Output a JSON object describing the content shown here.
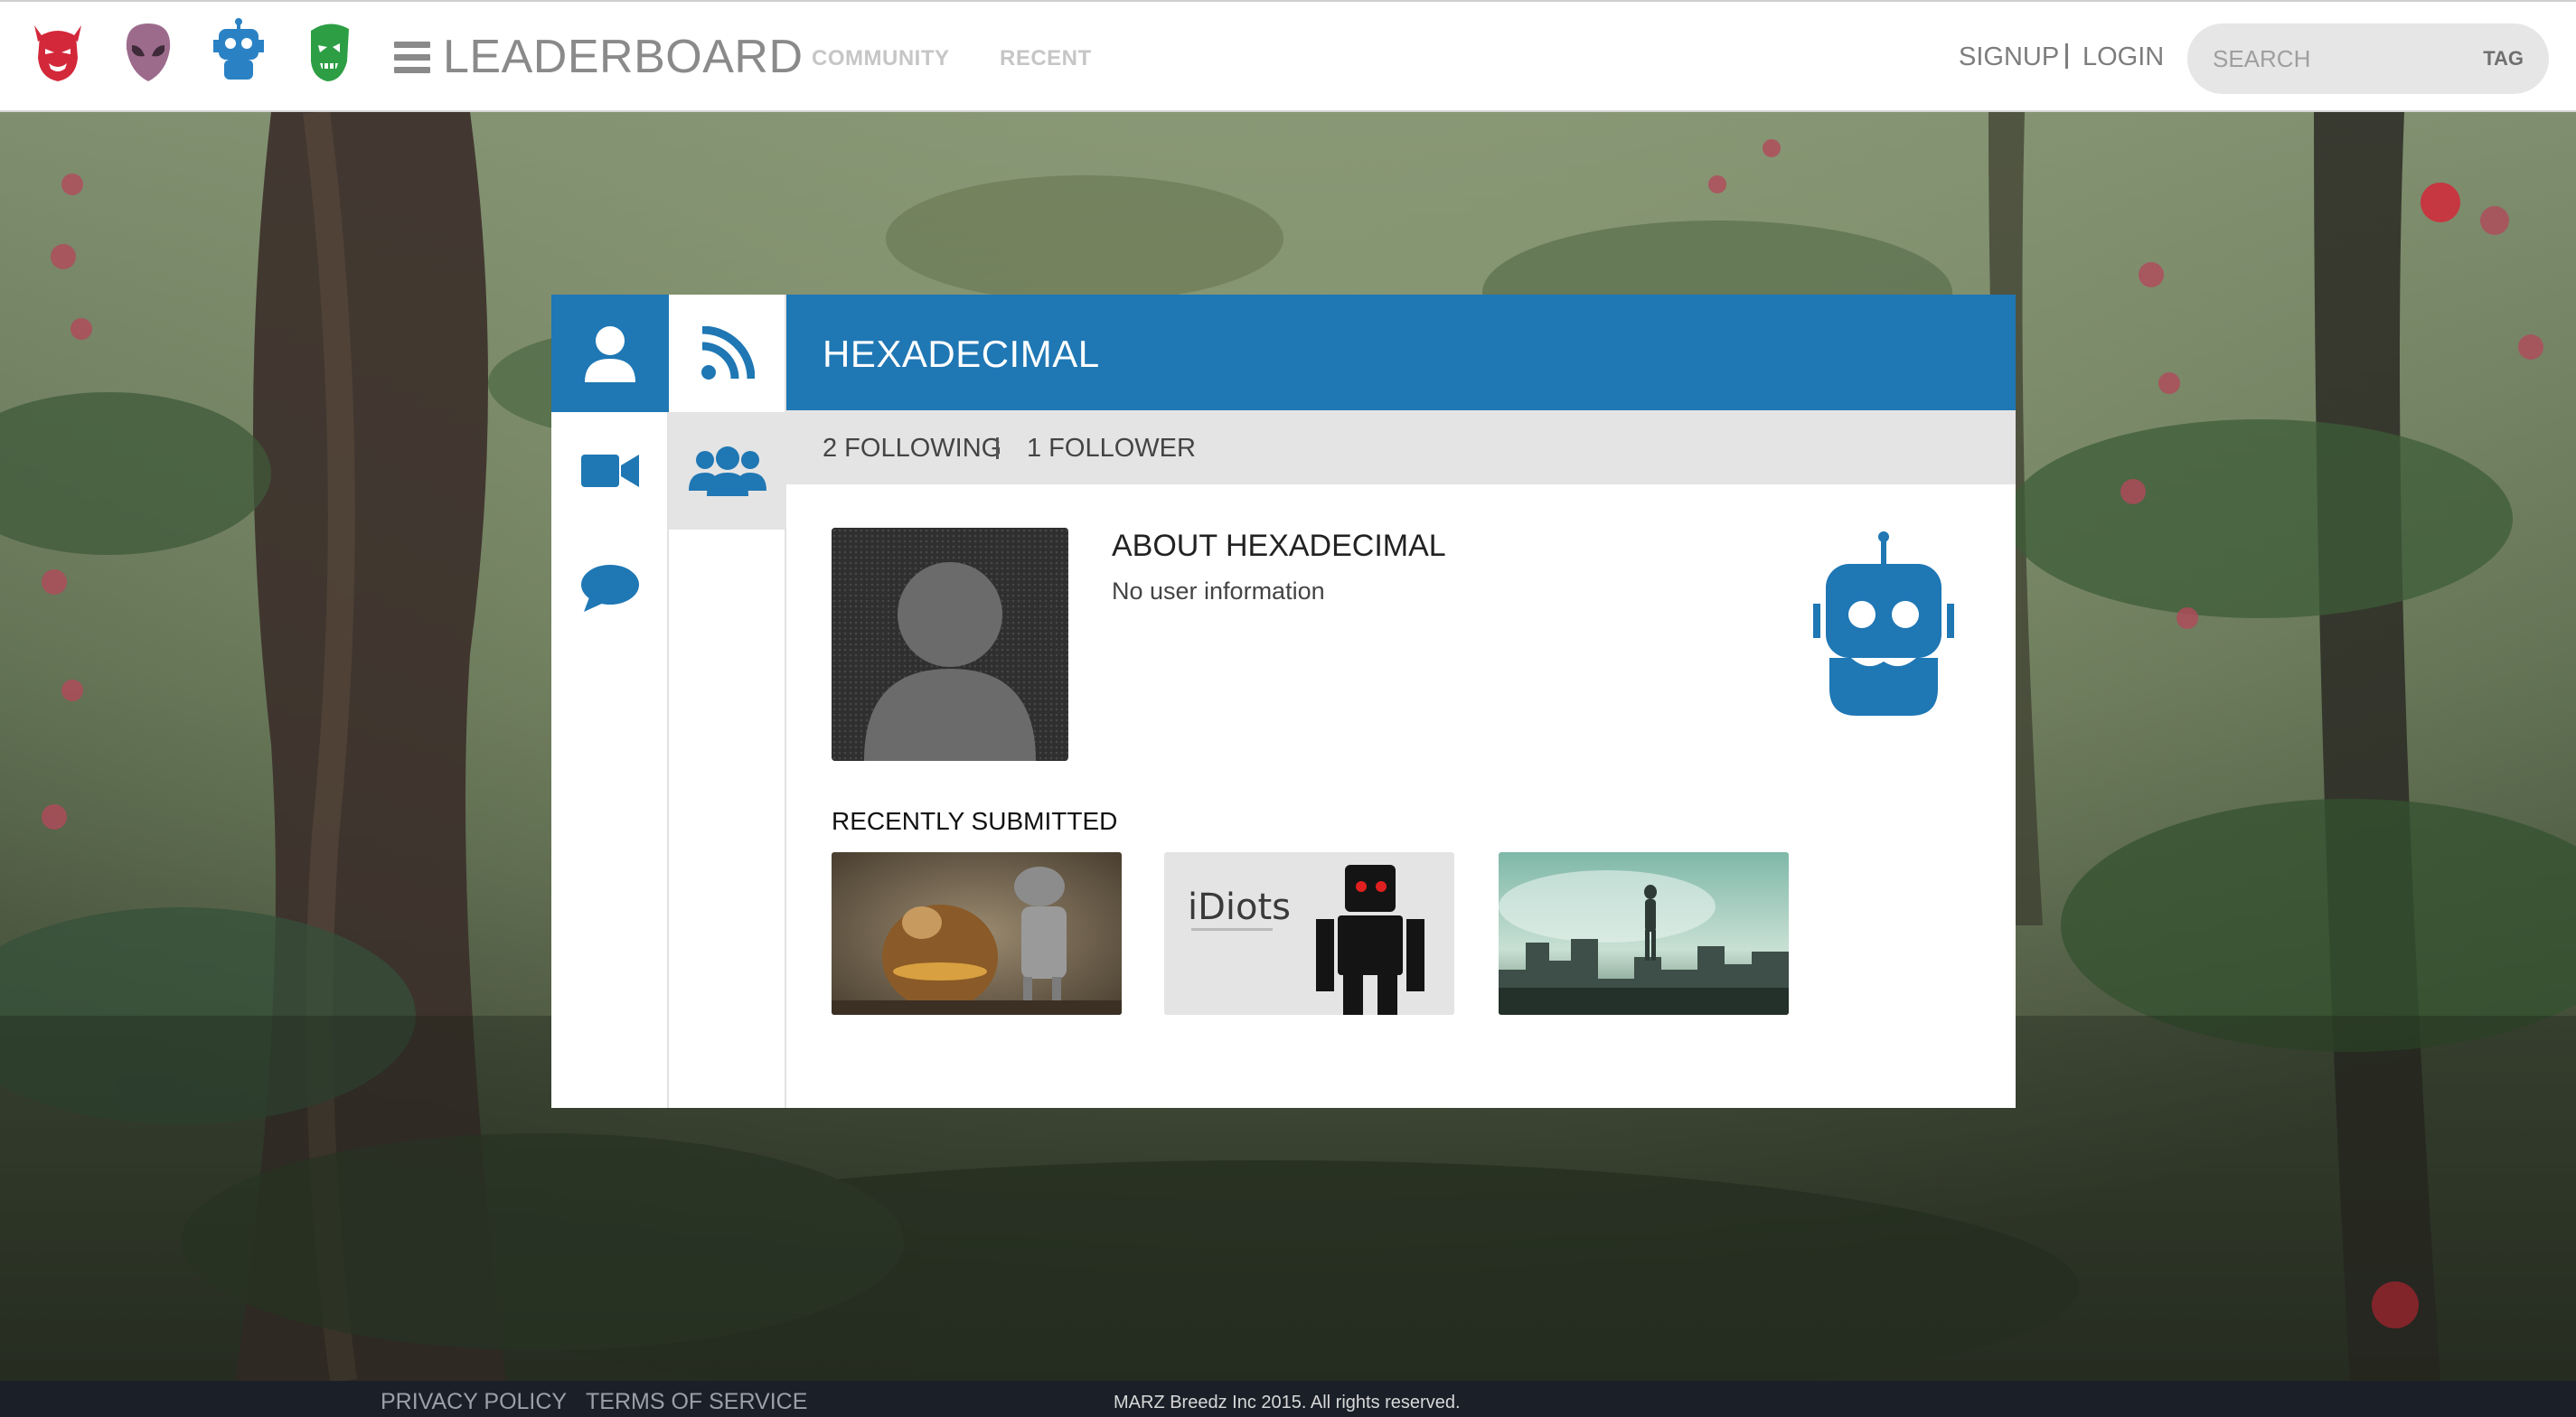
{
  "header": {
    "brand": "LEADERBOARD",
    "nav": {
      "community": "COMMUNITY",
      "recent": "RECENT"
    },
    "auth": {
      "signup": "SIGNUP",
      "login": "LOGIN"
    },
    "search": {
      "placeholder": "SEARCH",
      "tag_label": "TAG"
    },
    "mascots": [
      {
        "icon": "red-demon-mascot-icon",
        "color": "#d3283a"
      },
      {
        "icon": "purple-alien-mascot-icon",
        "color": "#9c6b8c"
      },
      {
        "icon": "blue-robot-mascot-icon",
        "color": "#2a82c5"
      },
      {
        "icon": "green-zombie-mascot-icon",
        "color": "#2e9e45"
      }
    ]
  },
  "profile": {
    "username": "HEXADECIMAL",
    "following": "2 FOLLOWING",
    "followers": "1 FOLLOWER",
    "about_title": "ABOUT HEXADECIMAL",
    "about_text": "No user information",
    "badge_icon": "blue-robot-badge-icon",
    "tabs": [
      "user-icon",
      "video-camera-icon",
      "chat-bubble-icon",
      "rss-feed-icon",
      "group-icon"
    ],
    "recently_submitted_title": "RECENTLY SUBMITTED",
    "submissions": [
      {
        "thumb": "animated-characters-thumbnail"
      },
      {
        "thumb": "idiots-robot-thumbnail",
        "caption": "iDiots"
      },
      {
        "thumb": "flying-man-city-thumbnail"
      }
    ]
  },
  "colors": {
    "accent": "#1f77b4",
    "stats_bg": "#e4e4e4",
    "footer_bg": "#1a1f28"
  },
  "footer": {
    "privacy": "PRIVACY POLICY",
    "terms": "TERMS OF SERVICE",
    "copyright": "MARZ Breedz Inc 2015. All rights reserved."
  }
}
